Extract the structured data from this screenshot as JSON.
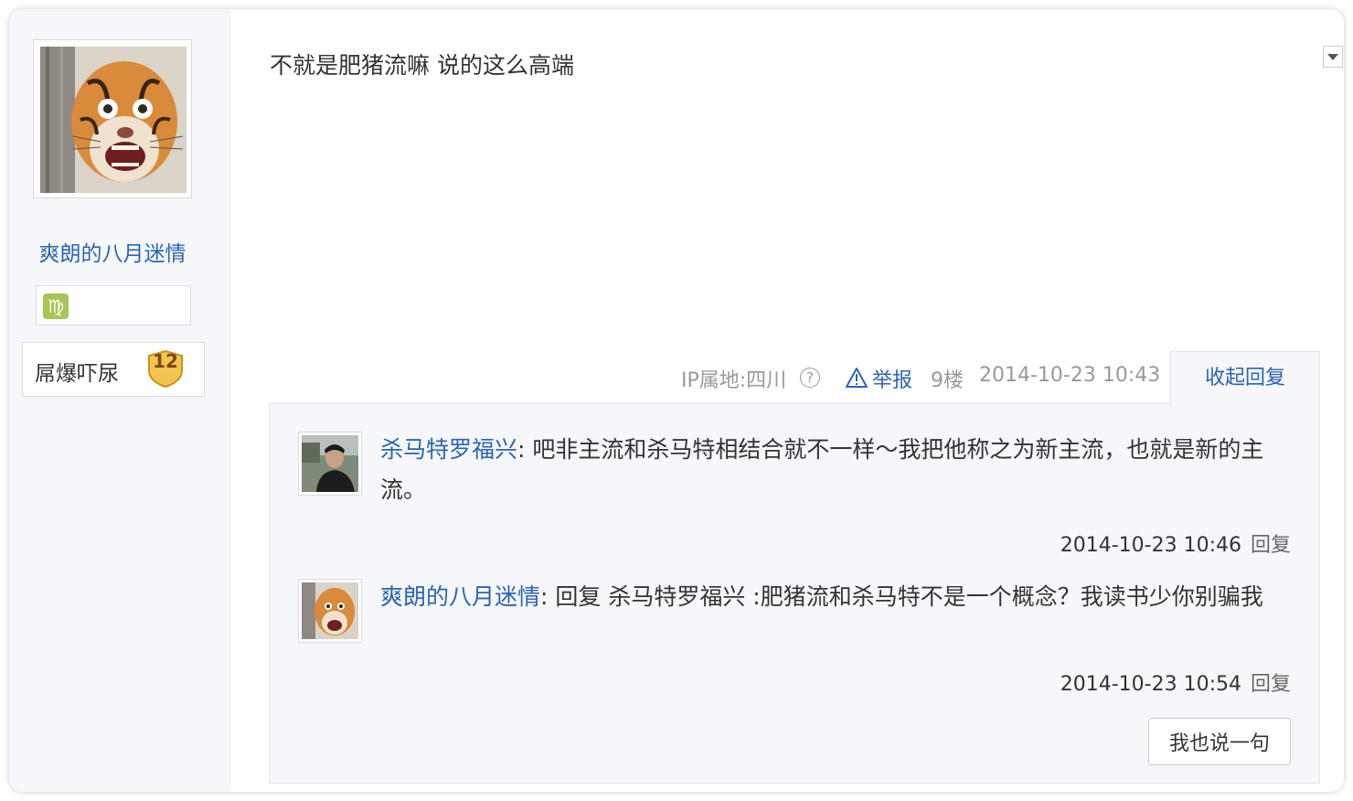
{
  "author": {
    "name": "爽朗的八月迷情",
    "zodiac_glyph": "♍",
    "level_title": "屌爆吓尿",
    "level": "12"
  },
  "post": {
    "content": "不就是肥猪流嘛 说的这么高端",
    "ip_location": "IP属地:四川",
    "help_glyph": "?",
    "report_label": "举报",
    "floor": "9楼",
    "time": "2014-10-23 10:43",
    "collapse_label": "收起回复"
  },
  "replies": [
    {
      "user": "杀马特罗福兴",
      "separator": ":",
      "text": " 吧非主流和杀马特相结合就不一样～我把他称之为新主流，也就是新的主流。",
      "time": "2014-10-23 10:46",
      "reply_label": "回复"
    },
    {
      "user": "爽朗的八月迷情",
      "separator": ":",
      "text": " 回复 杀马特罗福兴 :肥猪流和杀马特不是一个概念？我读书少你别骗我",
      "time": "2014-10-23 10:54",
      "reply_label": "回复"
    }
  ],
  "say_button_label": "我也说一句",
  "colors": {
    "link": "#2d64b3",
    "meta": "#999999",
    "panel_bg": "#f5f7fa"
  }
}
